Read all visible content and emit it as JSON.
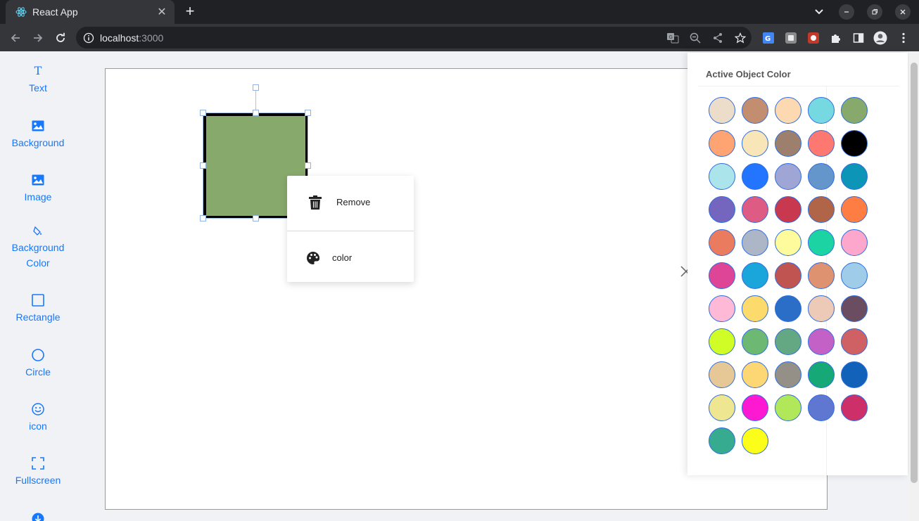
{
  "browser": {
    "tab_title": "React App",
    "url_host": "localhost",
    "url_port": ":3000",
    "icons": [
      "react-favicon",
      "close-tab-icon",
      "new-tab-icon",
      "tab-search-icon",
      "minimize-icon",
      "restore-icon",
      "window-close-icon",
      "back-icon",
      "forward-icon",
      "reload-icon",
      "info-icon",
      "translate-icon",
      "zoom-icon",
      "share-icon",
      "bookmark-star-icon",
      "extension-icon",
      "puzzle-icon",
      "side-panel-icon",
      "profile-icon",
      "menu-icon"
    ]
  },
  "sidebar": {
    "items": [
      {
        "label": "Text",
        "icon": "text-icon"
      },
      {
        "label": "Background",
        "icon": "image-icon"
      },
      {
        "label": "Image",
        "icon": "image-icon"
      },
      {
        "label": "Background",
        "label2": "Color",
        "icon": "paint-bucket-icon"
      },
      {
        "label": "Rectangle",
        "icon": "rectangle-icon"
      },
      {
        "label": "Circle",
        "icon": "circle-icon"
      },
      {
        "label": "icon",
        "icon": "smile-icon"
      },
      {
        "label": "Fullscreen",
        "icon": "fullscreen-icon"
      }
    ]
  },
  "canvas": {
    "shape_fill": "#87a96b",
    "shape_stroke": "#000000"
  },
  "context_menu": {
    "remove_label": "Remove",
    "color_label": "color"
  },
  "color_panel": {
    "title": "Active Object Color",
    "colors": [
      "#ecdcca",
      "#c38e70",
      "#fcd9b1",
      "#76d8e1",
      "#87a96b",
      "#fda472",
      "#f8e5b8",
      "#9c7f6d",
      "#fc7870",
      "#000000",
      "#ace4ec",
      "#2374fe",
      "#9fa6d6",
      "#6596cb",
      "#0d95b8",
      "#7465bf",
      "#de5b83",
      "#c8394f",
      "#b06549",
      "#fd7d43",
      "#ea7b5f",
      "#adb6c7",
      "#fdfb9c",
      "#1cd3a4",
      "#fda7cd",
      "#df4596",
      "#1aa5db",
      "#c05451",
      "#df9270",
      "#9fcde9",
      "#fdb9d6",
      "#fcdb6c",
      "#2b6ec8",
      "#eccab7",
      "#6a4d60",
      "#d0fd26",
      "#6db873",
      "#64a883",
      "#c461c6",
      "#cf6064",
      "#e6c796",
      "#fcd773",
      "#949088",
      "#16a877",
      "#1362b9",
      "#efe692",
      "#fd19d2",
      "#b0e85a",
      "#5f77d0",
      "#cd2f68",
      "#37ab8f",
      "#fdfd1a"
    ]
  }
}
